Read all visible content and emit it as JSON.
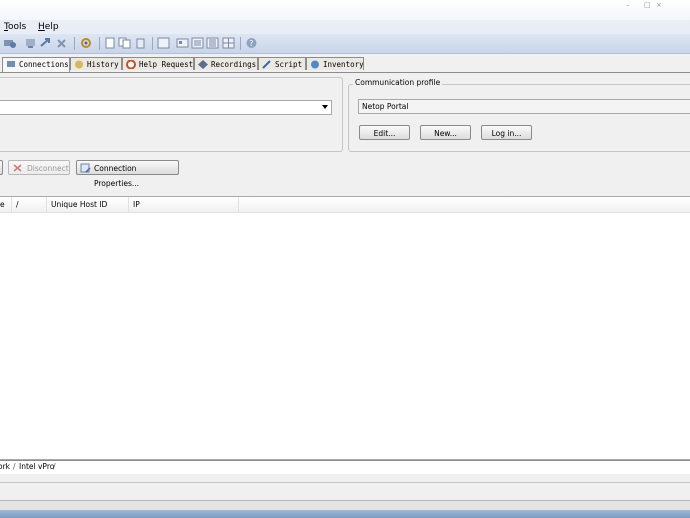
{
  "menu": {
    "tools": "Tools",
    "tools_key": "T",
    "tools_rest": "ools",
    "help": "Help",
    "help_key": "H",
    "help_rest": "elp"
  },
  "tabs": [
    {
      "label": "Connections",
      "icon": "connections-icon"
    },
    {
      "label": "History",
      "icon": "history-icon"
    },
    {
      "label": "Help Request",
      "icon": "help-request-icon"
    },
    {
      "label": "Recordings",
      "icon": "recordings-icon"
    },
    {
      "label": "Script",
      "icon": "script-icon"
    },
    {
      "label": "Inventory",
      "icon": "inventory-icon"
    }
  ],
  "communication_profile": {
    "label": "Communication profile",
    "selected": "Netop Portal",
    "edit_label": "Edit...",
    "new_label": "New...",
    "login_label": "Log in..."
  },
  "actions": {
    "disconnect_label": "Disconnect",
    "connection_properties_label": "Connection Properties..."
  },
  "list": {
    "columns": [
      "e",
      "/",
      "Unique Host ID",
      "IP"
    ]
  },
  "bottom_tabs": [
    "ork",
    "Intel vPro"
  ],
  "colors": {
    "toolbar": "#c8d5e8",
    "menubar": "#e9eef6",
    "taskbar": "#7b9bc4"
  }
}
